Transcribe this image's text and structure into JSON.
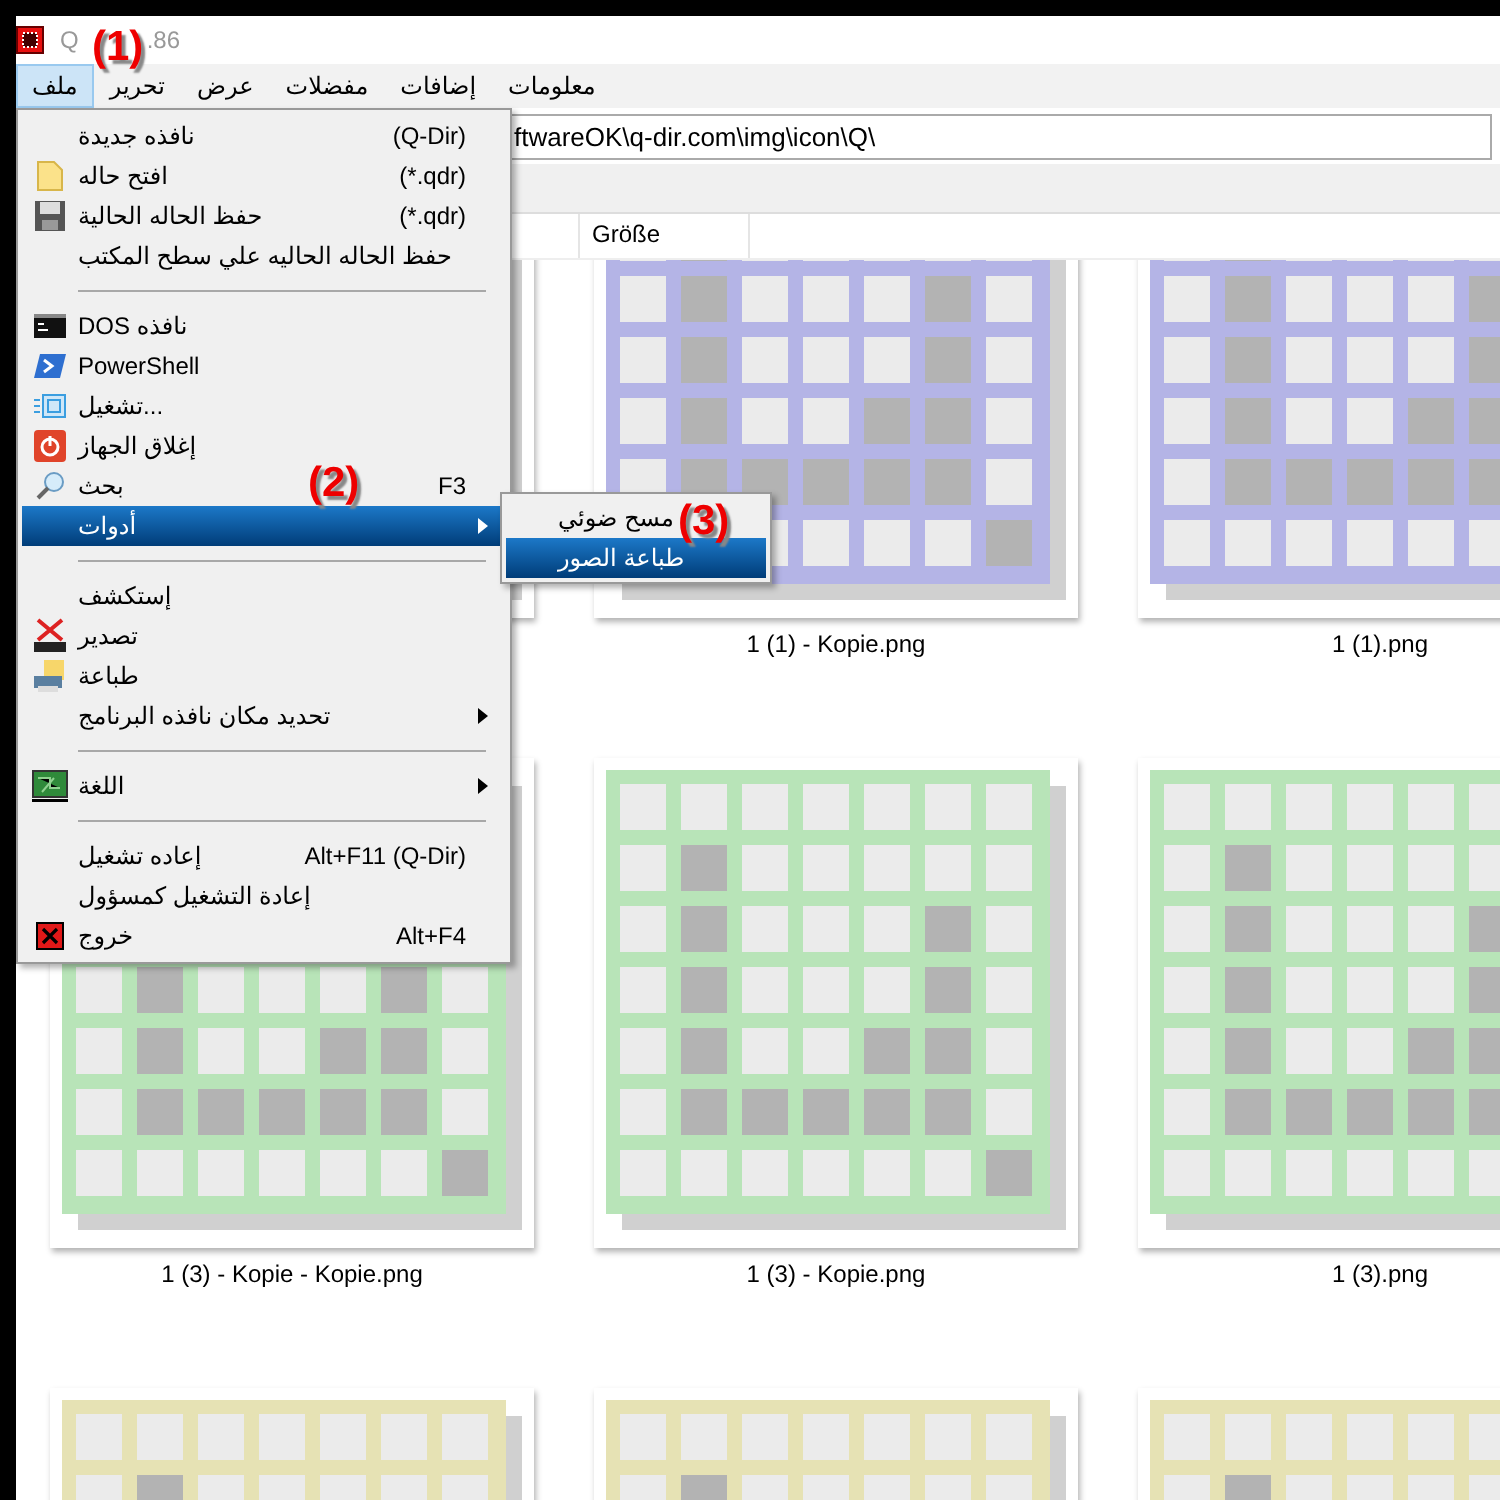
{
  "window": {
    "title_start": "Q",
    "title_end": ".86"
  },
  "menu_bar": [
    {
      "label": "معلومات",
      "selected": false
    },
    {
      "label": "إضافات",
      "selected": false
    },
    {
      "label": "مفضلات",
      "selected": false
    },
    {
      "label": "عرض",
      "selected": false
    },
    {
      "label": "تحرير",
      "selected": false
    },
    {
      "label": "ملف",
      "selected": true
    }
  ],
  "address_bar": {
    "value": "ftwareOK\\q-dir.com\\img\\icon\\Q\\"
  },
  "columns": [
    "Größe"
  ],
  "file_menu": {
    "items": [
      {
        "kind": "item",
        "label": "نافذه جديدة",
        "shortcut": "(Q-Dir)",
        "selected": false,
        "submenu": false
      },
      {
        "kind": "item",
        "label": "افتح حاله",
        "shortcut": "(*.qdr)",
        "selected": false,
        "submenu": false
      },
      {
        "kind": "item",
        "label": "حفظ الحاله الحالية",
        "shortcut": "(*.qdr)",
        "selected": false,
        "submenu": false
      },
      {
        "kind": "item",
        "label": "حفظ الحاله الحاليه علي سطح المكتب",
        "selected": false,
        "submenu": false
      },
      {
        "kind": "separator"
      },
      {
        "kind": "item",
        "label": "DOS نافذه",
        "selected": false,
        "submenu": false
      },
      {
        "kind": "item",
        "label": "PowerShell",
        "selected": false,
        "submenu": false
      },
      {
        "kind": "item",
        "label": "تشغيل...",
        "selected": false,
        "submenu": false
      },
      {
        "kind": "item",
        "label": "إغلاق الجهاز",
        "selected": false,
        "submenu": false
      },
      {
        "kind": "item",
        "label": "بحث",
        "shortcut": "F3",
        "selected": false,
        "submenu": false
      },
      {
        "kind": "item",
        "label": "أدوات",
        "selected": true,
        "submenu": true
      },
      {
        "kind": "separator"
      },
      {
        "kind": "item",
        "label": "إستكشف",
        "selected": false,
        "submenu": false
      },
      {
        "kind": "item",
        "label": "تصدير",
        "selected": false,
        "submenu": false
      },
      {
        "kind": "item",
        "label": "طباعة",
        "selected": false,
        "submenu": false
      },
      {
        "kind": "item",
        "label": "تحديد مكان نافذه البرنامج",
        "selected": false,
        "submenu": true
      },
      {
        "kind": "separator"
      },
      {
        "kind": "item",
        "label": "اللغة",
        "selected": false,
        "submenu": true
      },
      {
        "kind": "separator"
      },
      {
        "kind": "item",
        "label": "إعاده تشغيل",
        "shortcut": "Alt+F11 (Q-Dir)",
        "selected": false,
        "submenu": false
      },
      {
        "kind": "item",
        "label": "إعادة التشغيل كمسؤول",
        "selected": false,
        "submenu": false
      },
      {
        "kind": "item",
        "label": "خروج",
        "shortcut": "Alt+F4",
        "selected": false,
        "submenu": false
      }
    ]
  },
  "tools_submenu": {
    "items": [
      {
        "label": "مسح ضوئي",
        "selected": false
      },
      {
        "label": "طباعة الصور",
        "selected": true
      }
    ]
  },
  "annotations": [
    "(1)",
    "(2)",
    "(3)"
  ],
  "thumbnail_rows": [
    [
      {
        "label": "1 (1).png",
        "color": "#b4b4e6"
      },
      {
        "label": "1 (1) - Kopie.png",
        "color": "#b4b4e6"
      },
      {}
    ],
    [
      {
        "label": "1 (3).png",
        "color": "#b8e4b8"
      },
      {
        "label": "1 (3) - Kopie.png",
        "color": "#b8e4b8"
      },
      {
        "label": "1 (3) - Kopie - Kopie.png",
        "color": "#b8e4b8"
      }
    ],
    [
      {
        "color": "#e6e2b4"
      },
      {
        "color": "#e6e2b4"
      },
      {
        "color": "#e6e2b4"
      }
    ]
  ]
}
